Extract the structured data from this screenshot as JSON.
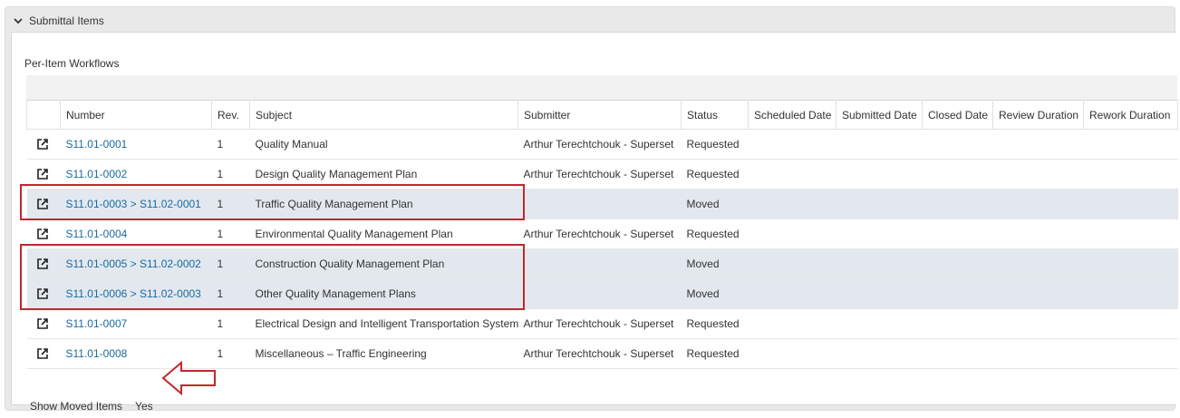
{
  "section": {
    "title": "Submittal Items"
  },
  "workflows": {
    "title": "Per-Item Workflows"
  },
  "table": {
    "columns": [
      "",
      "Number",
      "Rev.",
      "Subject",
      "Submitter",
      "Status",
      "Scheduled Date",
      "Submitted Date",
      "Closed Date",
      "Review Duration",
      "Rework Duration"
    ],
    "rows": [
      {
        "number": "S11.01-0001",
        "rev": "1",
        "subject": "Quality Manual",
        "submitter": "Arthur Terechtchouk - Superset",
        "status": "Requested",
        "moved": false
      },
      {
        "number": "S11.01-0002",
        "rev": "1",
        "subject": "Design Quality Management Plan",
        "submitter": "Arthur Terechtchouk - Superset",
        "status": "Requested",
        "moved": false
      },
      {
        "number": "S11.01-0003 > S11.02-0001",
        "rev": "1",
        "subject": "Traffic Quality Management Plan",
        "submitter": "",
        "status": "Moved",
        "moved": true
      },
      {
        "number": "S11.01-0004",
        "rev": "1",
        "subject": "Environmental Quality Management Plan",
        "submitter": "Arthur Terechtchouk - Superset",
        "status": "Requested",
        "moved": false
      },
      {
        "number": "S11.01-0005 > S11.02-0002",
        "rev": "1",
        "subject": "Construction Quality Management Plan",
        "submitter": "",
        "status": "Moved",
        "moved": true
      },
      {
        "number": "S11.01-0006 > S11.02-0003",
        "rev": "1",
        "subject": "Other Quality Management Plans",
        "submitter": "",
        "status": "Moved",
        "moved": true
      },
      {
        "number": "S11.01-0007",
        "rev": "1",
        "subject": "Electrical Design and Intelligent Transportation System",
        "submitter": "Arthur Terechtchouk - Superset",
        "status": "Requested",
        "moved": false
      },
      {
        "number": "S11.01-0008",
        "rev": "1",
        "subject": "Miscellaneous – Traffic Engineering",
        "submitter": "Arthur Terechtchouk - Superset",
        "status": "Requested",
        "moved": false
      }
    ]
  },
  "footer": {
    "label": "Show Moved Items",
    "value": "Yes"
  },
  "icons": {
    "row_action": "open-external-icon",
    "section_toggle": "chevron-down-icon"
  },
  "colors": {
    "link": "#1a6aa0",
    "moved_row": "#e3e8ef",
    "highlight": "#c0272d"
  }
}
